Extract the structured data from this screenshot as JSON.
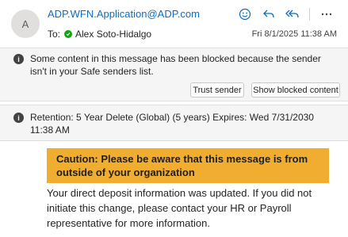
{
  "header": {
    "avatar_initial": "A",
    "sender": "ADP.WFN.Application@ADP.com",
    "to_label": "To:",
    "recipient": "Alex Soto-Hidalgo",
    "date": "Fri 8/1/2025 11:38 AM",
    "action_icons": [
      "emoji-icon",
      "reply-icon",
      "reply-all-icon",
      "more-icon"
    ]
  },
  "blocked_banner": {
    "message": "Some content in this message has been blocked because the sender isn't in your Safe senders list.",
    "trust_sender_label": "Trust sender",
    "show_blocked_label": "Show blocked content"
  },
  "retention_banner": {
    "message": "Retention: 5 Year Delete (Global) (5 years) Expires: Wed 7/31/2030 11:38 AM"
  },
  "email_body": {
    "caution": "Caution: Please be aware that this message is from outside of your organization",
    "message": "Your direct deposit information was updated. If you did not initiate this change, please contact your HR or Payroll representative for more information."
  },
  "colors": {
    "accent": "#0f6cbd",
    "presence_available": "#13a10e",
    "caution_bg": "#f0ad30",
    "banner_bg": "#f5f5f5"
  }
}
